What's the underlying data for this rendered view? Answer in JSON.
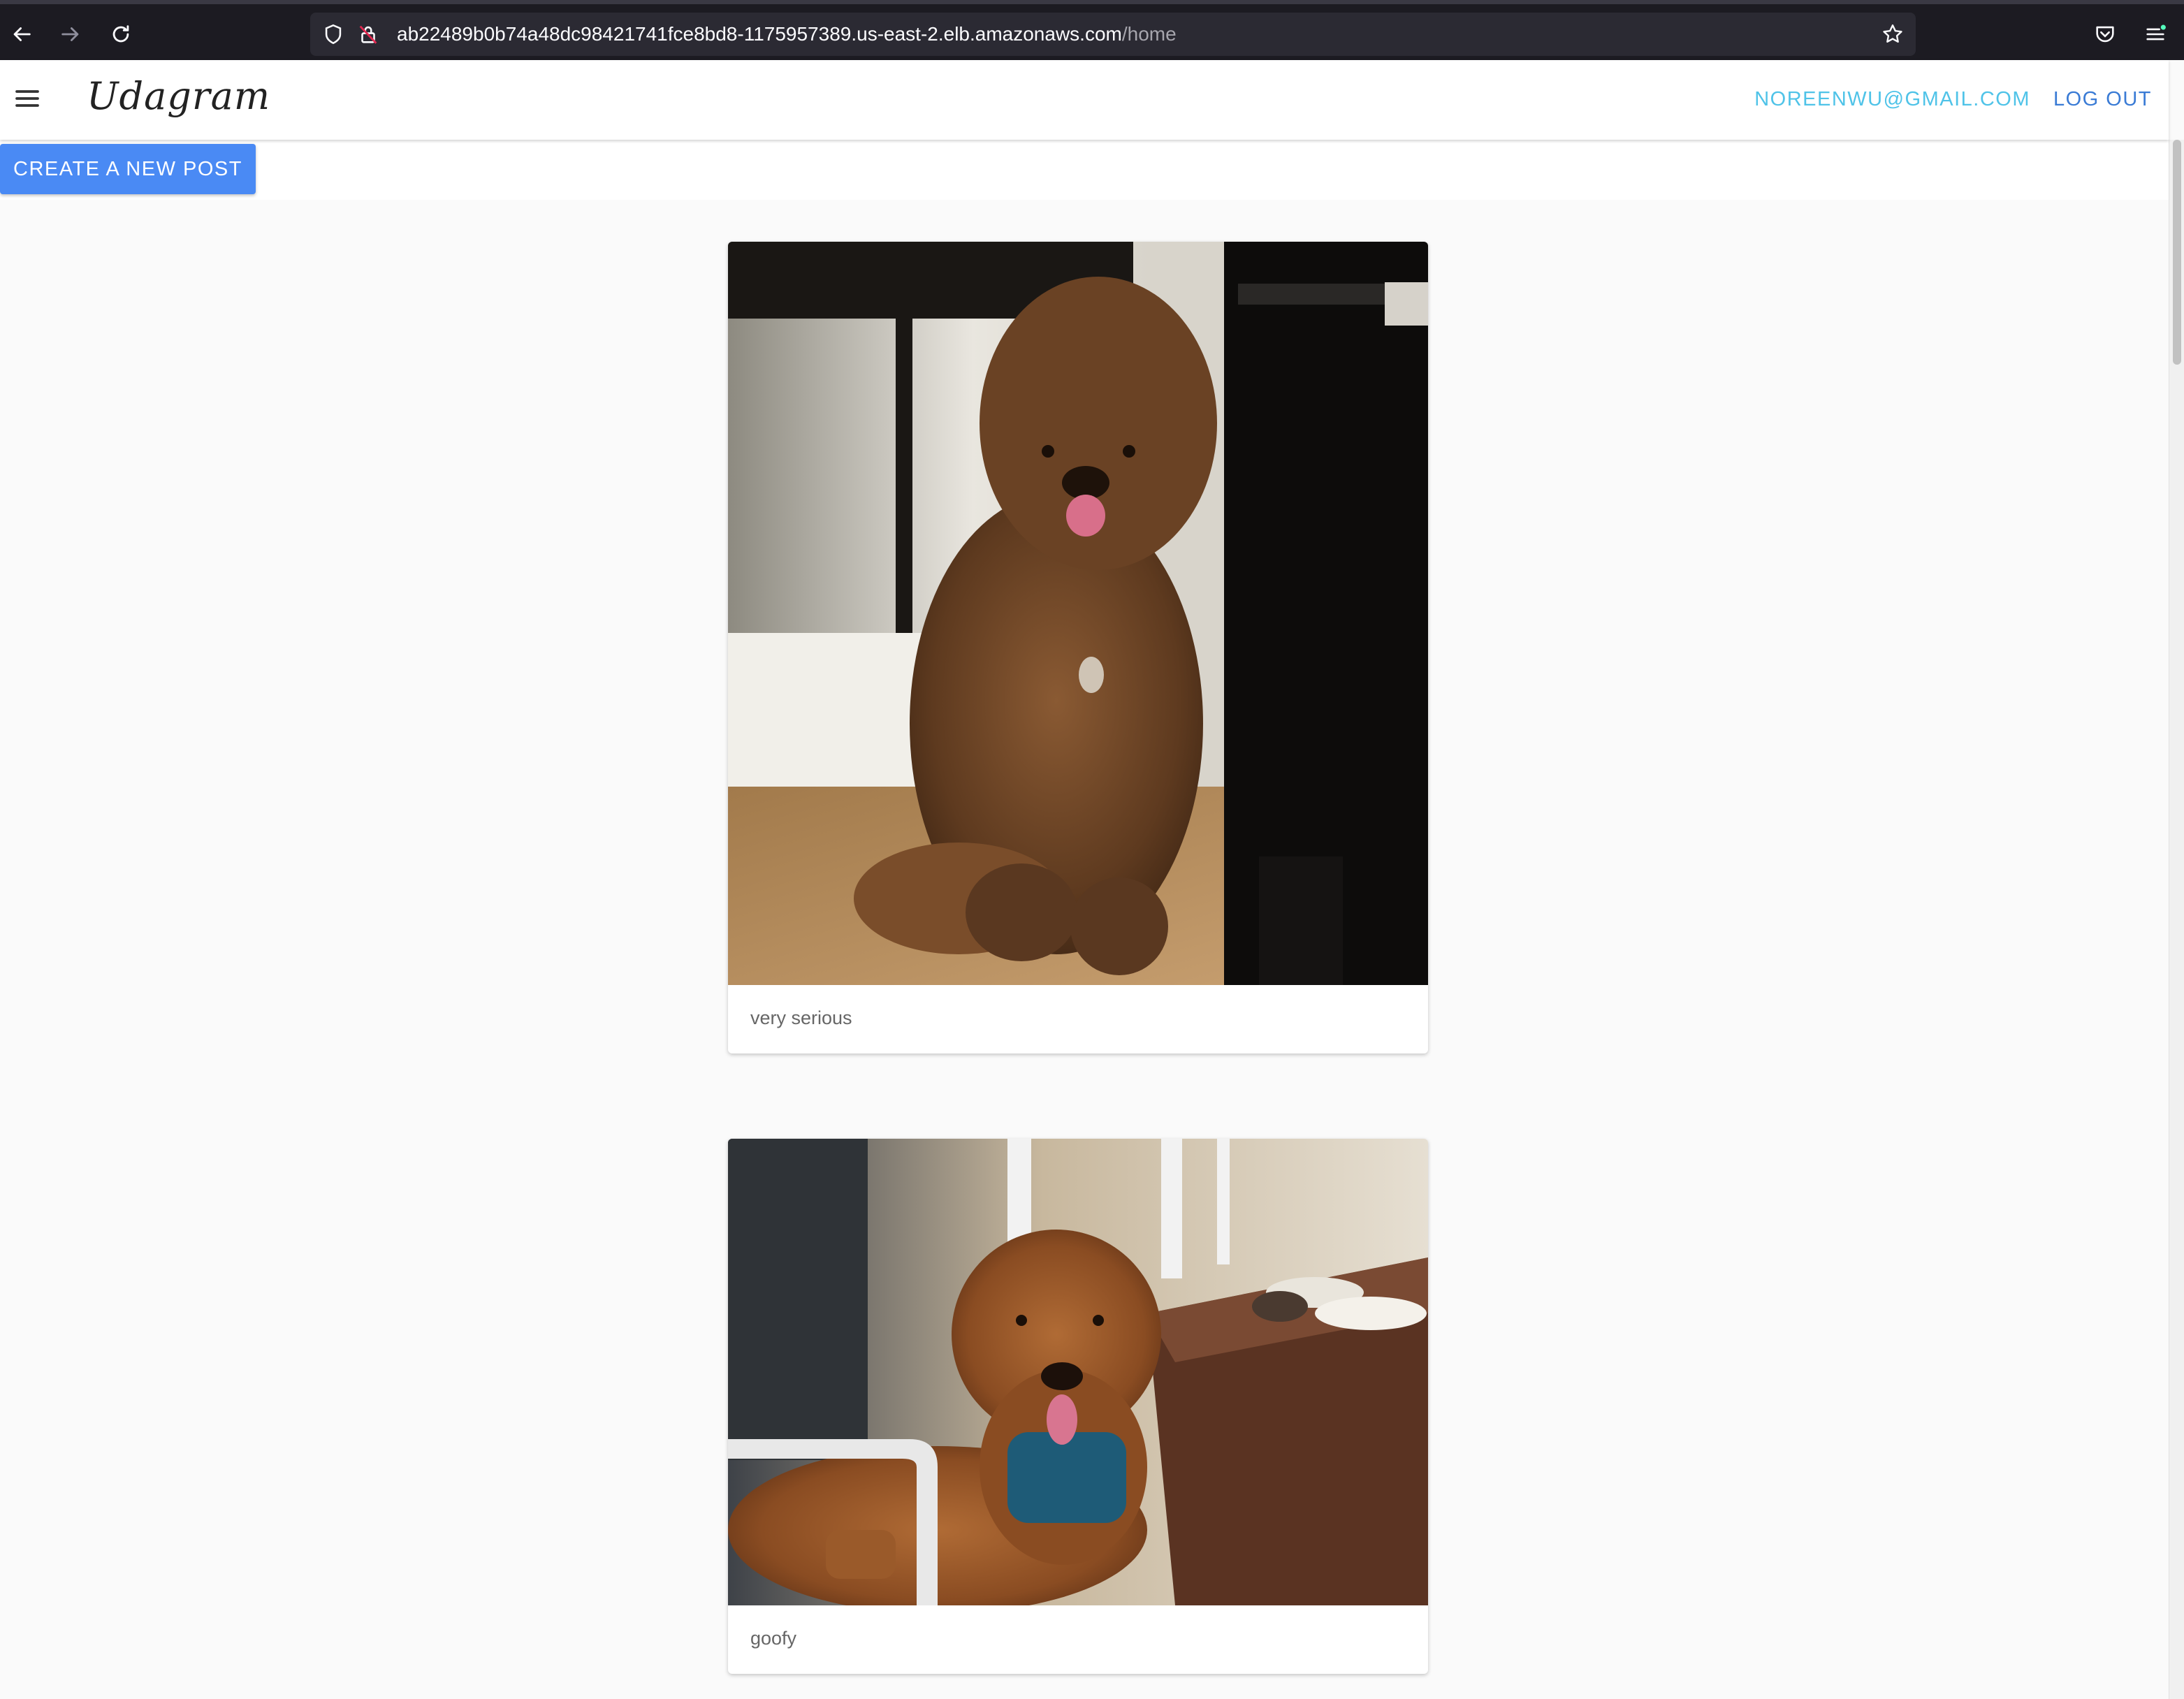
{
  "browser": {
    "url_host": "ab22489b0b74a48dc98421741fce8bd8-1175957389.us-east-2.elb.amazonaws.com",
    "url_path": "/home"
  },
  "header": {
    "brand": "Udagram",
    "user_email": "NOREENWU@GMAIL.COM",
    "logout_label": "LOG OUT"
  },
  "toolbar": {
    "create_label": "CREATE A NEW POST"
  },
  "feed": {
    "posts": [
      {
        "caption": "very serious",
        "image": "brown-curly-dog-sitting-photo"
      },
      {
        "caption": "goofy",
        "image": "brown-curly-dog-lying-on-deck-photo"
      }
    ]
  }
}
